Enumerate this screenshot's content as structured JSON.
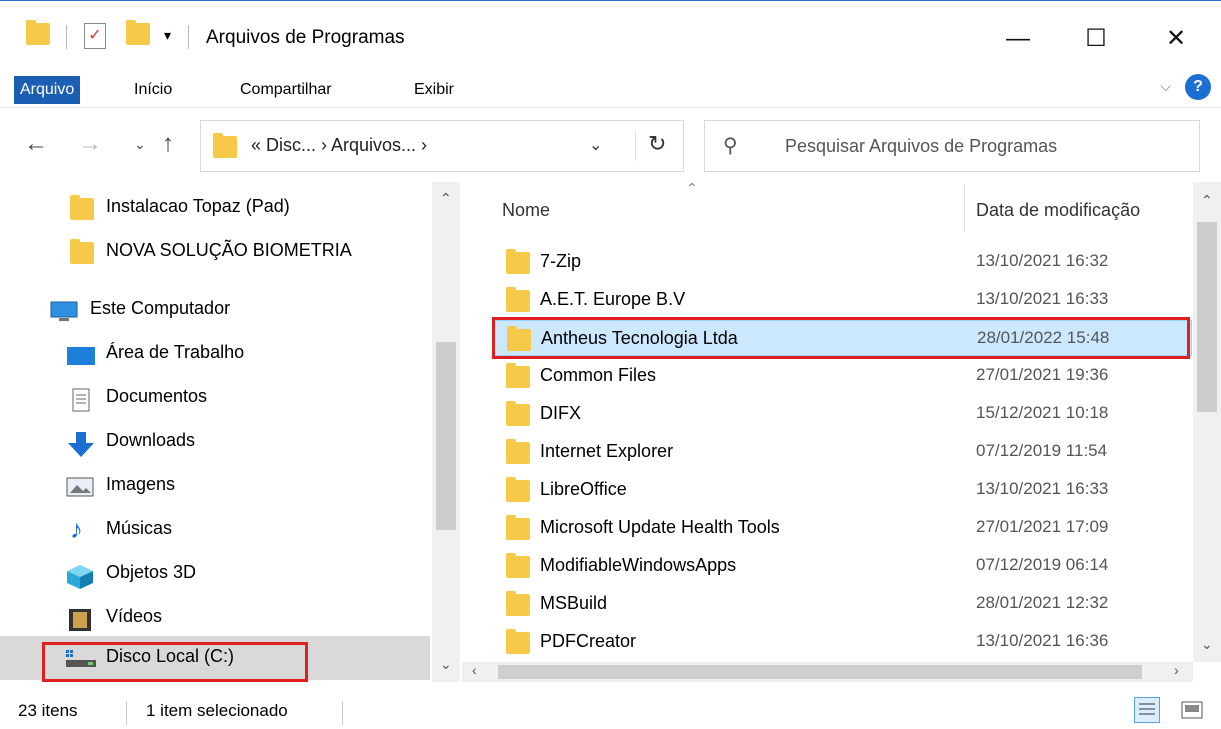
{
  "window": {
    "title": "Arquivos de Programas",
    "minimize_glyph": "—",
    "maximize_glyph": "☐",
    "close_glyph": "✕"
  },
  "ribbon": {
    "tabs": [
      {
        "label": "Arquivo"
      },
      {
        "label": "Início"
      },
      {
        "label": "Compartilhar"
      },
      {
        "label": "Exibir"
      }
    ],
    "help_label": "?",
    "expand_glyph": "⌵"
  },
  "address": {
    "path": "« Disc... › Arquivos... ›",
    "search_placeholder": "Pesquisar Arquivos de Programas"
  },
  "nav": {
    "items": [
      {
        "label": "Instalacao Topaz (Pad)",
        "icon": "folder-icon"
      },
      {
        "label": "NOVA SOLUÇÃO BIOMETRIA",
        "icon": "folder-icon"
      },
      {
        "label": "Este Computador",
        "icon": "computer-icon"
      },
      {
        "label": "Área de Trabalho",
        "icon": "desktop-icon"
      },
      {
        "label": "Documentos",
        "icon": "documents-icon"
      },
      {
        "label": "Downloads",
        "icon": "downloads-icon"
      },
      {
        "label": "Imagens",
        "icon": "pictures-icon"
      },
      {
        "label": "Músicas",
        "icon": "music-icon"
      },
      {
        "label": "Objetos 3D",
        "icon": "objects-3d-icon"
      },
      {
        "label": "Vídeos",
        "icon": "videos-icon"
      },
      {
        "label": "Disco Local (C:)",
        "icon": "drive-icon"
      }
    ]
  },
  "files": {
    "col_name": "Nome",
    "col_date": "Data de modificação",
    "rows": [
      {
        "name": "7-Zip",
        "date": "13/10/2021 16:32"
      },
      {
        "name": "A.E.T. Europe B.V",
        "date": "13/10/2021 16:33"
      },
      {
        "name": "Antheus Tecnologia Ltda",
        "date": "28/01/2022 15:48"
      },
      {
        "name": "Common Files",
        "date": "27/01/2021 19:36"
      },
      {
        "name": "DIFX",
        "date": "15/12/2021 10:18"
      },
      {
        "name": "Internet Explorer",
        "date": "07/12/2019 11:54"
      },
      {
        "name": "LibreOffice",
        "date": "13/10/2021 16:33"
      },
      {
        "name": "Microsoft Update Health Tools",
        "date": "27/01/2021 17:09"
      },
      {
        "name": "ModifiableWindowsApps",
        "date": "07/12/2019 06:14"
      },
      {
        "name": "MSBuild",
        "date": "28/01/2021 12:32"
      },
      {
        "name": "PDFCreator",
        "date": "13/10/2021 16:36"
      }
    ]
  },
  "status": {
    "count": "23 itens",
    "selection": "1 item selecionado"
  },
  "colors": {
    "accent": "#1a5fb4",
    "folder": "#f7c948",
    "selection": "#cce8ff",
    "highlight_box": "#e02020"
  }
}
